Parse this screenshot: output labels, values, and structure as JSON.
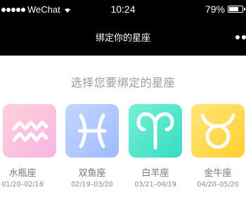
{
  "status_bar": {
    "carrier": "WeChat",
    "time": "10:24",
    "battery_text": "79%",
    "battery_level": 0.79
  },
  "nav": {
    "title": "绑定你的星座",
    "more_icon": "more-dots-icon"
  },
  "prompt": "选择您要绑定的星座",
  "zodiacs": [
    {
      "name": "水瓶座",
      "dates": "01/20–02/18",
      "icon": "aquarius-icon",
      "colors": [
        "#ffd0d8",
        "#f7b4e6"
      ]
    },
    {
      "name": "双鱼座",
      "dates": "02/19–03/20",
      "icon": "pisces-icon",
      "colors": [
        "#c4d6ff",
        "#9fbaff"
      ]
    },
    {
      "name": "白羊座",
      "dates": "03/21–04/19",
      "icon": "aries-icon",
      "colors": [
        "#78f0d6",
        "#33dcc2"
      ]
    },
    {
      "name": "金牛座",
      "dates": "04/20–05/20",
      "icon": "taurus-icon",
      "colors": [
        "#ffe57a",
        "#ffcf2e"
      ]
    }
  ]
}
